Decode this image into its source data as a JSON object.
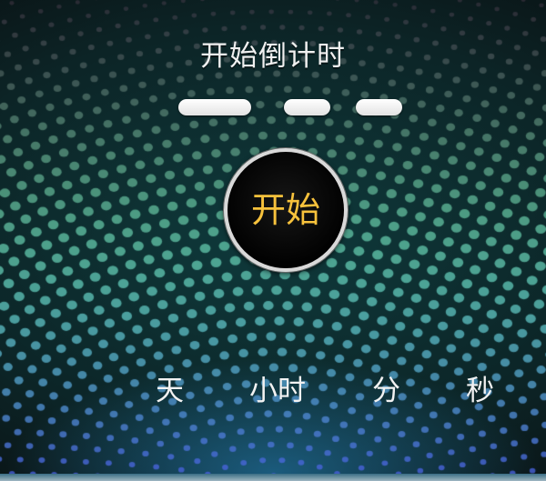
{
  "title": "开始倒计时",
  "start_button": {
    "label": "开始"
  },
  "units": {
    "days": "天",
    "hours": "小时",
    "minutes": "分",
    "seconds": "秒"
  },
  "colors": {
    "accent": "#f7c23c",
    "text": "#f2f2f2",
    "dot_teal": "#4fc0b0",
    "dot_blue": "#3a9ad0"
  }
}
